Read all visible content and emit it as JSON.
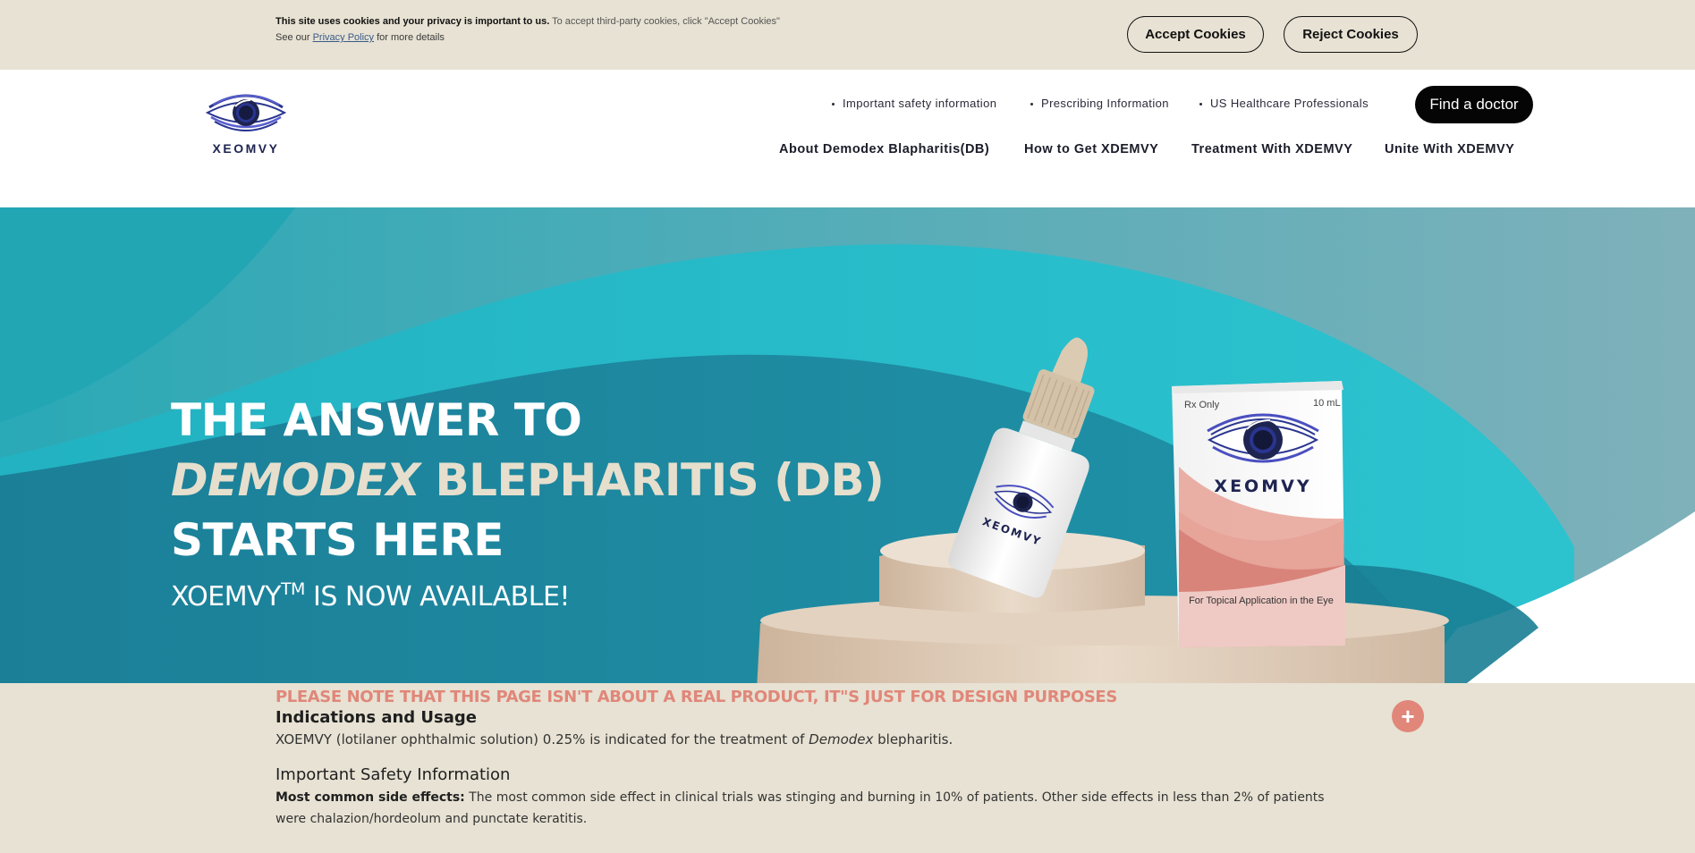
{
  "cookie_bar": {
    "bold_text": "This site uses cookies and your privacy is important to us.",
    "text": "To accept third-party cookies, click \"Accept Cookies\"",
    "see_our": "See our",
    "privacy_link": "Privacy Policy",
    "more_details": "for more details",
    "accept_label": "Accept Cookies",
    "reject_label": "Reject Cookies"
  },
  "header": {
    "logo_text": "XEOMVY",
    "utility_nav": [
      {
        "label": "Important safety information"
      },
      {
        "label": "Prescribing Information"
      },
      {
        "label": "US Healthcare Professionals"
      }
    ],
    "find_doctor_label": "Find a doctor",
    "main_nav": [
      {
        "label": "About Demodex Blapharitis(DB)"
      },
      {
        "label": "How to Get XDEMVY"
      },
      {
        "label": "Treatment With XDEMVY"
      },
      {
        "label": "Unite With XDEMVY"
      }
    ]
  },
  "hero": {
    "line1": "THE ANSWER TO",
    "line2_italic": "DEMODEX",
    "line2_rest": " BLEPHARITIS (DB)",
    "line3": "STARTS HERE",
    "sub_brand": "XOEMVY",
    "sub_tm": "TM",
    "sub_rest": " IS NOW AVAILABLE!",
    "product": {
      "box_brand": "XEOMVY",
      "bottle_brand": "XEOMVY",
      "box_rx": "Rx Only",
      "box_size": "10 mL",
      "box_caption": "For Topical Application in the Eye"
    }
  },
  "isi": {
    "note": "PLEASE NOTE THAT THIS PAGE ISN'T ABOUT A REAL PRODUCT, IT\"S JUST FOR DESIGN PURPOSES",
    "indications_title": "Indications and Usage",
    "indications_pre": "XOEMVY (lotilaner ophthalmic solution) 0.25% is indicated for the treatment of ",
    "indications_italic": "Demodex",
    "indications_post": " blepharitis.",
    "safety_title": "Important Safety Information",
    "side_effects_label": "Most common side effects:",
    "side_effects_text": " The most common side effect in clinical trials was stinging and burning in 10% of patients. Other side effects in less than 2% of patients were chalazion/hordeolum and punctate keratitis.",
    "expand_symbol": "+"
  },
  "colors": {
    "cookie_bg": "#e7e2d3",
    "hero_teal": "#1b8aa0",
    "hero_light_teal": "#27bcc9",
    "accent_coral": "#e0877a",
    "navy": "#1e2450",
    "beige": "#e6dfcd"
  }
}
